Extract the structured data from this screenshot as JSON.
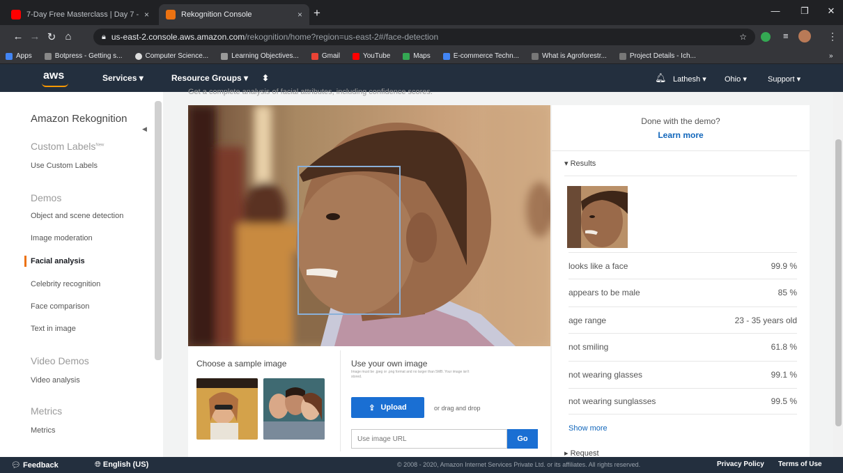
{
  "browser": {
    "tabs": [
      {
        "label": "7-Day Free Masterclass | Day 7 -",
        "icon": "youtube-icon",
        "color": "#ff0000"
      },
      {
        "label": "Rekognition Console",
        "icon": "aws-favicon",
        "color": "#ec7211"
      }
    ],
    "close_tab": "×",
    "new_tab": "+",
    "window_controls": {
      "minimize": "—",
      "restore": "❐",
      "close": "✕"
    },
    "url_host": "us-east-2.console.aws.amazon.com",
    "url_path": "/rekognition/home?region=us-east-2#/face-detection",
    "bookmarks": [
      {
        "label": "Apps",
        "color": "#4285f4"
      },
      {
        "label": "Botpress - Getting s...",
        "color": "#888888"
      },
      {
        "label": "Computer Science...",
        "color": "#dddddd"
      },
      {
        "label": "Learning Objectives...",
        "color": "#999999"
      },
      {
        "label": "Gmail",
        "color": "#ea4335"
      },
      {
        "label": "YouTube",
        "color": "#ff0000"
      },
      {
        "label": "Maps",
        "color": "#34a853"
      },
      {
        "label": "E-commerce Techn...",
        "color": "#4285f4"
      },
      {
        "label": "What is Agroforestr...",
        "color": "#777777"
      },
      {
        "label": "Project Details - Ich...",
        "color": "#777777"
      }
    ],
    "bookmarks_more": "»"
  },
  "aws_nav": {
    "logo": "aws",
    "services": "Services",
    "resource_groups": "Resource Groups",
    "user": "Lathesh",
    "region": "Ohio",
    "support": "Support"
  },
  "sidebar": {
    "title": "Amazon Rekognition",
    "custom_labels_head": "Custom Labels",
    "new_badge": "New",
    "use_custom_labels": "Use Custom Labels",
    "demos_head": "Demos",
    "demos": [
      "Object and scene detection",
      "Image moderation",
      "Facial analysis",
      "Celebrity recognition",
      "Face comparison",
      "Text in image"
    ],
    "video_demos_head": "Video Demos",
    "video_analysis": "Video analysis",
    "metrics_head": "Metrics",
    "metrics": "Metrics"
  },
  "main": {
    "cut_text": "Get a complete analysis of facial attributes, including confidence scores.",
    "sample_title": "Choose a sample image",
    "own_title": "Use your own image",
    "own_help": "Image must be .jpeg or .png format and no larger than 5MB. Your image isn't stored.",
    "upload_label": "Upload",
    "drag_drop": "or drag and drop",
    "url_placeholder": "Use image URL",
    "go_label": "Go"
  },
  "results": {
    "done_text": "Done with the demo?",
    "learn_more": "Learn more",
    "section": "Results",
    "rows": [
      {
        "label": "looks like a face",
        "value": "99.9 %"
      },
      {
        "label": "appears to be male",
        "value": "85 %"
      },
      {
        "label": "age range",
        "value": "23 - 35 years old"
      },
      {
        "label": "not smiling",
        "value": "61.8 %"
      },
      {
        "label": "not wearing glasses",
        "value": "99.1 %"
      },
      {
        "label": "not wearing sunglasses",
        "value": "99.5 %"
      }
    ],
    "show_more": "Show more",
    "request": "Request"
  },
  "footer": {
    "feedback": "Feedback",
    "language": "English (US)",
    "copyright": "© 2008 - 2020, Amazon Internet Services Private Ltd. or its affiliates. All rights reserved.",
    "privacy": "Privacy Policy",
    "terms": "Terms of Use"
  }
}
